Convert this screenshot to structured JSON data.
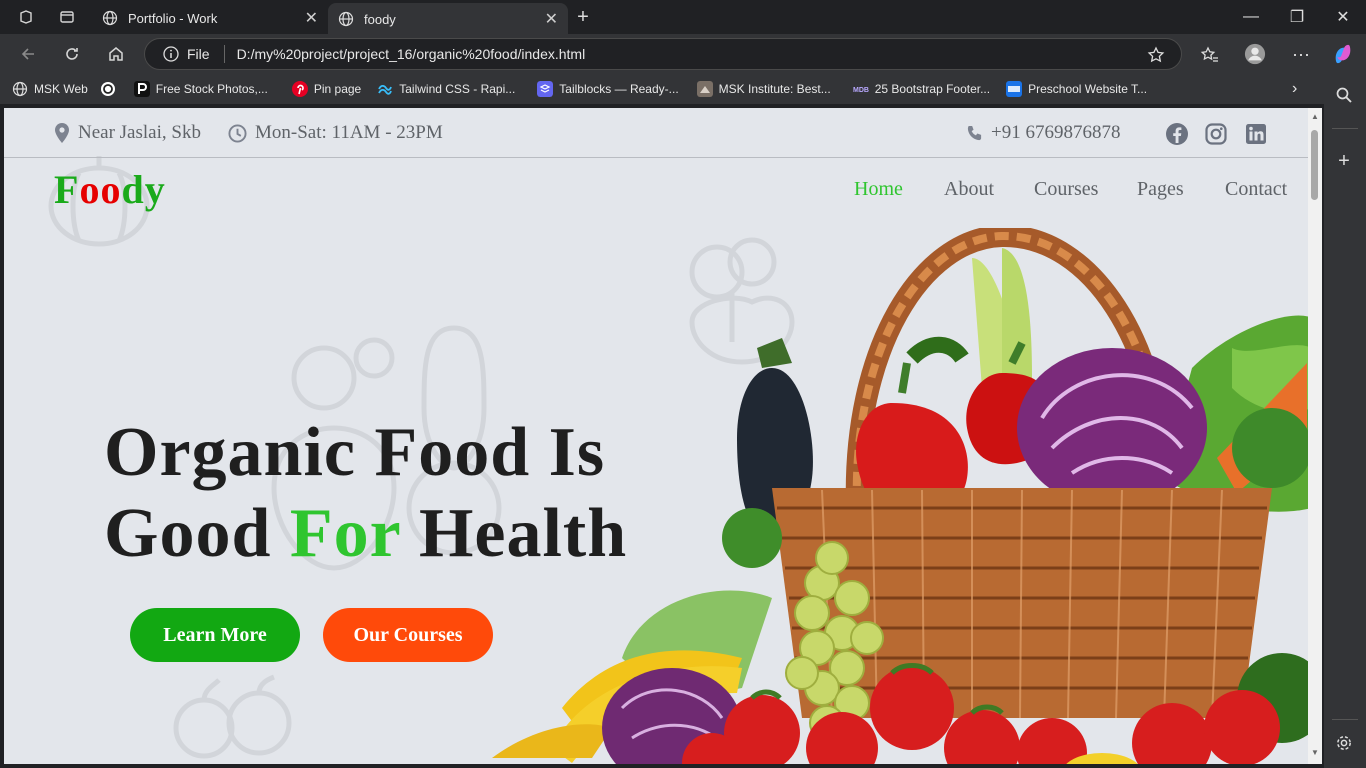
{
  "browser": {
    "tabs": [
      {
        "title": "Portfolio - Work"
      },
      {
        "title": "foody"
      }
    ],
    "address": {
      "scheme_label": "File",
      "url": "D:/my%20project/project_16/organic%20food/index.html"
    },
    "bookmarks": [
      {
        "label": "MSK Web",
        "color": "#9aa0a6"
      },
      {
        "label": "",
        "color": "#ffffff"
      },
      {
        "label": "Free Stock Photos,...",
        "color": "#ffffff"
      },
      {
        "label": "Pin page",
        "color": "#e60023"
      },
      {
        "label": "Tailwind CSS - Rapi...",
        "color": "#38bdf8"
      },
      {
        "label": "Tailblocks — Ready-...",
        "color": "#6366f1"
      },
      {
        "label": "MSK Institute: Best...",
        "color": "#8d8d8d"
      },
      {
        "label": "25 Bootstrap Footer...",
        "color": "#7b61ff"
      },
      {
        "label": "Preschool Website T...",
        "color": "#1a73e8"
      }
    ]
  },
  "page": {
    "topbar": {
      "location": "Near Jaslai, Skb",
      "hours": "Mon-Sat: 11AM - 23PM",
      "phone": "+91 6769876878",
      "social_icons": [
        "facebook-icon",
        "instagram-icon",
        "linkedin-icon"
      ]
    },
    "logo": {
      "letters": [
        "F",
        "oo",
        "d",
        "y"
      ],
      "colors": [
        "#1aaa1a",
        "#e60000",
        "#1aaa1a",
        "#1aaa1a"
      ]
    },
    "nav": [
      {
        "label": "Home",
        "active": true
      },
      {
        "label": "About"
      },
      {
        "label": "Courses"
      },
      {
        "label": "Pages"
      },
      {
        "label": "Contact"
      }
    ],
    "hero": {
      "line1": "Organic Food Is",
      "line2_a": "Good ",
      "line2_b": "For",
      "line2_c": " Health"
    },
    "buttons": {
      "learn_more": "Learn More",
      "our_courses": "Our Courses"
    },
    "colors": {
      "accent_green": "#12a812",
      "accent_orange": "#ff4a0a",
      "nav_active": "#2fc52f"
    }
  }
}
